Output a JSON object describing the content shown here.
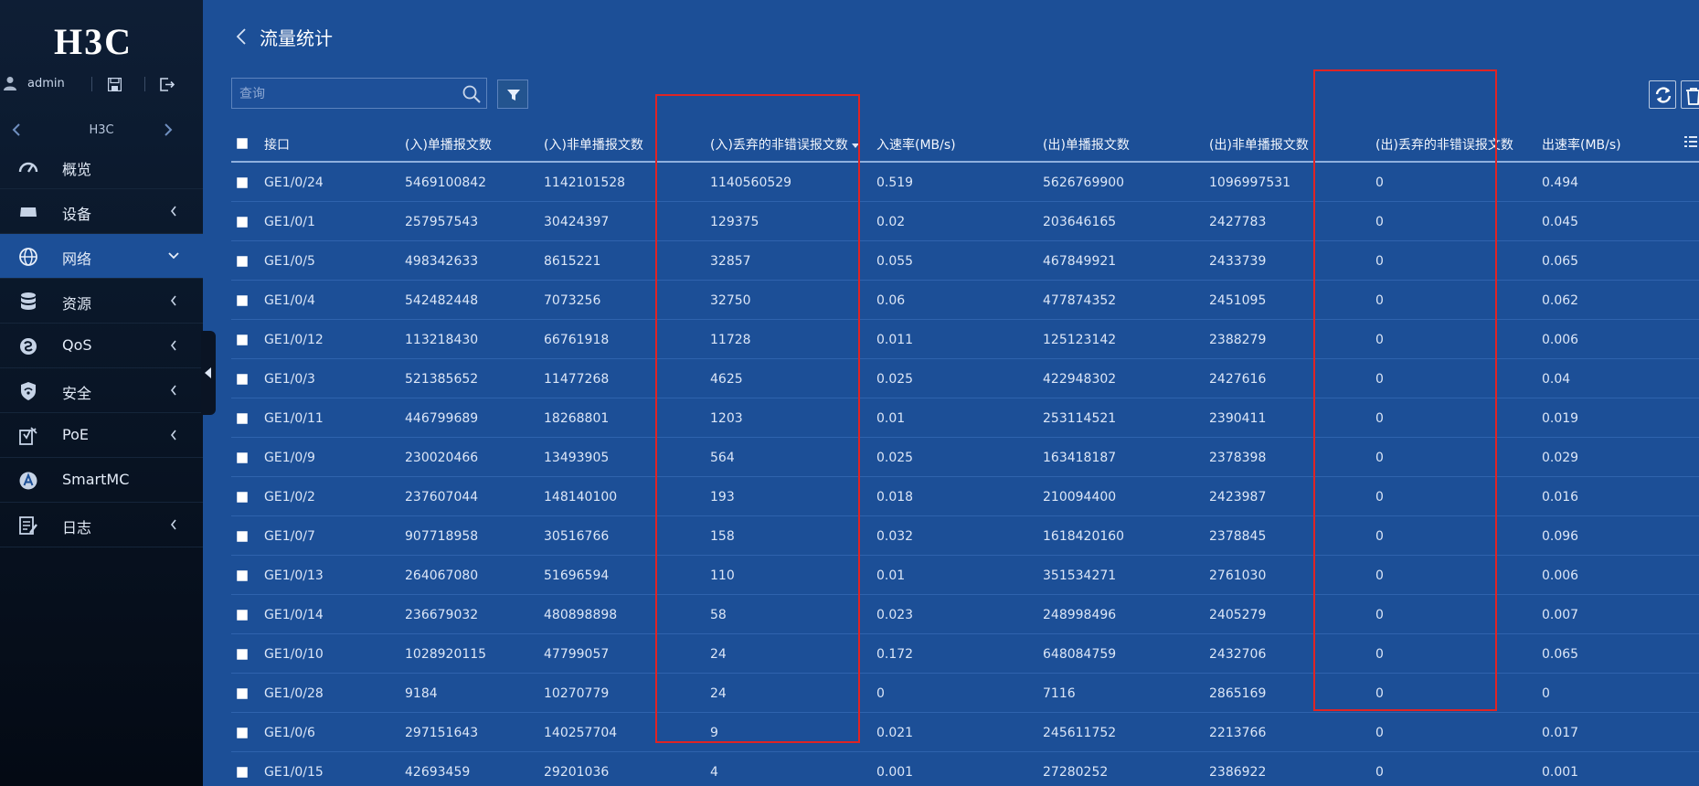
{
  "brand": {
    "logo_text": "H3C"
  },
  "user": {
    "name": "admin"
  },
  "nav_switch": {
    "label": "H3C"
  },
  "menu": [
    {
      "key": "overview",
      "label": "概览",
      "icon": "dashboard-icon",
      "has_chevron": false,
      "active": false
    },
    {
      "key": "device",
      "label": "设备",
      "icon": "device-icon",
      "has_chevron": true,
      "active": false
    },
    {
      "key": "network",
      "label": "网络",
      "icon": "globe-icon",
      "has_chevron": true,
      "active": true
    },
    {
      "key": "resource",
      "label": "资源",
      "icon": "database-icon",
      "has_chevron": true,
      "active": false
    },
    {
      "key": "qos",
      "label": "QoS",
      "icon": "qos-icon",
      "has_chevron": true,
      "active": false
    },
    {
      "key": "security",
      "label": "安全",
      "icon": "shield-icon",
      "has_chevron": true,
      "active": false
    },
    {
      "key": "poe",
      "label": "PoE",
      "icon": "poe-icon",
      "has_chevron": true,
      "active": false
    },
    {
      "key": "smartmc",
      "label": "SmartMC",
      "icon": "smartmc-icon",
      "has_chevron": false,
      "active": false
    },
    {
      "key": "log",
      "label": "日志",
      "icon": "log-icon",
      "has_chevron": true,
      "active": false
    }
  ],
  "page": {
    "title": "流量统计"
  },
  "search": {
    "placeholder": "查询"
  },
  "table": {
    "columns": [
      "接口",
      "(入)单播报文数",
      "(入)非单播报文数",
      "(入)丢弃的非错误报文数",
      "入速率(MB/s)",
      "(出)单播报文数",
      "(出)非单播报文数",
      "(出)丢弃的非错误报文数",
      "出速率(MB/s)"
    ],
    "sorted_column": 3,
    "rows": [
      [
        "GE1/0/24",
        "5469100842",
        "1142101528",
        "1140560529",
        "0.519",
        "5626769900",
        "1096997531",
        "0",
        "0.494"
      ],
      [
        "GE1/0/1",
        "257957543",
        "30424397",
        "129375",
        "0.02",
        "203646165",
        "2427783",
        "0",
        "0.045"
      ],
      [
        "GE1/0/5",
        "498342633",
        "8615221",
        "32857",
        "0.055",
        "467849921",
        "2433739",
        "0",
        "0.065"
      ],
      [
        "GE1/0/4",
        "542482448",
        "7073256",
        "32750",
        "0.06",
        "477874352",
        "2451095",
        "0",
        "0.062"
      ],
      [
        "GE1/0/12",
        "113218430",
        "66761918",
        "11728",
        "0.011",
        "125123142",
        "2388279",
        "0",
        "0.006"
      ],
      [
        "GE1/0/3",
        "521385652",
        "11477268",
        "4625",
        "0.025",
        "422948302",
        "2427616",
        "0",
        "0.04"
      ],
      [
        "GE1/0/11",
        "446799689",
        "18268801",
        "1203",
        "0.01",
        "253114521",
        "2390411",
        "0",
        "0.019"
      ],
      [
        "GE1/0/9",
        "230020466",
        "13493905",
        "564",
        "0.025",
        "163418187",
        "2378398",
        "0",
        "0.029"
      ],
      [
        "GE1/0/2",
        "237607044",
        "148140100",
        "193",
        "0.018",
        "210094400",
        "2423987",
        "0",
        "0.016"
      ],
      [
        "GE1/0/7",
        "907718958",
        "30516766",
        "158",
        "0.032",
        "1618420160",
        "2378845",
        "0",
        "0.096"
      ],
      [
        "GE1/0/13",
        "264067080",
        "51696594",
        "110",
        "0.01",
        "351534271",
        "2761030",
        "0",
        "0.006"
      ],
      [
        "GE1/0/14",
        "236679032",
        "480898898",
        "58",
        "0.023",
        "248998496",
        "2405279",
        "0",
        "0.007"
      ],
      [
        "GE1/0/10",
        "1028920115",
        "47799057",
        "24",
        "0.172",
        "648084759",
        "2432706",
        "0",
        "0.065"
      ],
      [
        "GE1/0/28",
        "9184",
        "10270779",
        "24",
        "0",
        "7116",
        "2865169",
        "0",
        "0"
      ],
      [
        "GE1/0/6",
        "297151643",
        "140257704",
        "9",
        "0.021",
        "245611752",
        "2213766",
        "0",
        "0.017"
      ],
      [
        "GE1/0/15",
        "42693459",
        "29201036",
        "4",
        "0.001",
        "27280252",
        "2386922",
        "0",
        "0.001"
      ]
    ]
  },
  "colors": {
    "sidebar_bg": "#0a1729",
    "content_bg": "#1c4f97",
    "highlight_border": "#e02424"
  }
}
